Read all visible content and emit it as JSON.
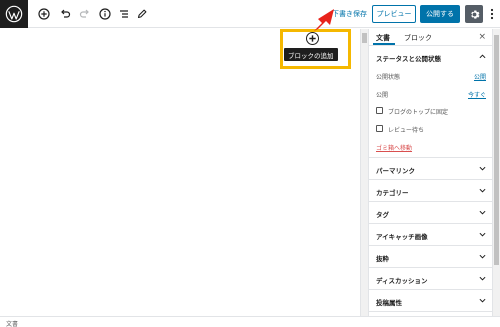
{
  "toolbar": {
    "save_draft_label": "下書き保存",
    "preview_label": "プレビュー",
    "publish_label": "公開する",
    "icons": [
      "wordpress-logo-icon",
      "add-block-icon",
      "undo-icon",
      "redo-icon",
      "info-icon",
      "outline-icon",
      "edit-icon",
      "gear-icon",
      "more-vertical-icon"
    ]
  },
  "editor": {
    "add_block_tooltip": "ブロックの追加",
    "highlight_color": "#f5b800",
    "arrow_color": "#e8231b"
  },
  "sidebar": {
    "tabs": [
      {
        "label": "文書"
      },
      {
        "label": "ブロック"
      }
    ],
    "close_label": "×",
    "status_panel": {
      "title": "ステータスと公開状態",
      "visibility_label": "公開状態",
      "visibility_value": "公開",
      "publish_label": "公開",
      "publish_value": "今すぐ",
      "stick_to_front_label": "ブログのトップに固定",
      "pending_review_label": "レビュー待ち",
      "trash_label": "ゴミ箱へ移動"
    },
    "panels": [
      {
        "label": "パーマリンク"
      },
      {
        "label": "カテゴリー"
      },
      {
        "label": "タグ"
      },
      {
        "label": "アイキャッチ画像"
      },
      {
        "label": "抜粋"
      },
      {
        "label": "ディスカッション"
      },
      {
        "label": "投稿属性"
      }
    ]
  },
  "footer": {
    "breadcrumb": "文書"
  },
  "colors": {
    "accent": "#0073aa",
    "dark": "#1e1e1e",
    "settings_button": "#555d66",
    "trash": "#d94f4f"
  }
}
